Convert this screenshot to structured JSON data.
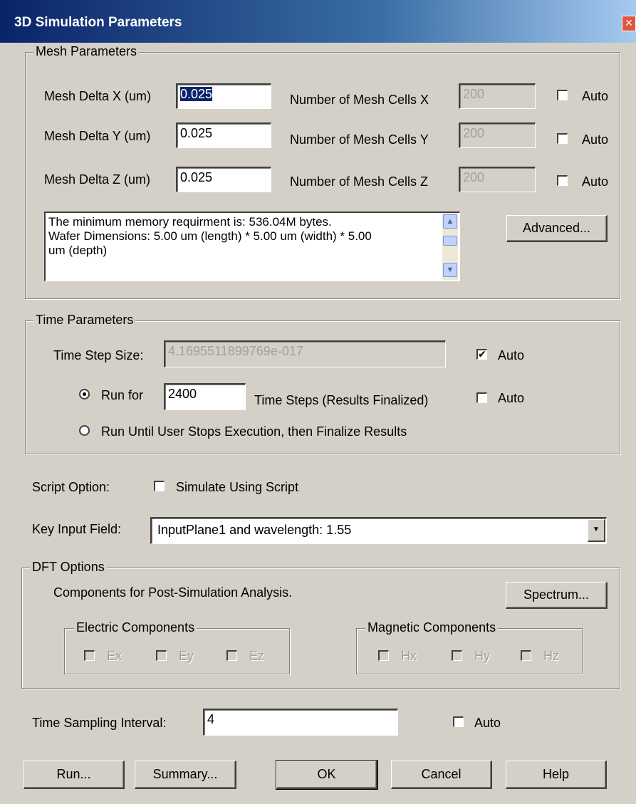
{
  "window": {
    "title": "3D Simulation Parameters",
    "close_glyph": "✕"
  },
  "mesh": {
    "legend": "Mesh Parameters",
    "rows": [
      {
        "delta_label": "Mesh Delta X (um)",
        "delta_value": "0.025",
        "cells_label": "Number of Mesh Cells X",
        "cells_value": "200",
        "auto_label": "Auto",
        "auto_checked": false
      },
      {
        "delta_label": "Mesh Delta Y (um)",
        "delta_value": "0.025",
        "cells_label": "Number of Mesh Cells Y",
        "cells_value": "200",
        "auto_label": "Auto",
        "auto_checked": false
      },
      {
        "delta_label": "Mesh Delta Z (um)",
        "delta_value": "0.025",
        "cells_label": "Number of Mesh Cells Z",
        "cells_value": "200",
        "auto_label": "Auto",
        "auto_checked": false
      }
    ],
    "info_lines": [
      "The minimum memory requirment is: 536.04M bytes.",
      "Wafer Dimensions: 5.00 um (length) * 5.00 um (width) * 5.00",
      "um (depth)"
    ],
    "advanced_label": "Advanced..."
  },
  "time": {
    "legend": "Time Parameters",
    "step_label": "Time Step Size:",
    "step_value": "4.1695511899769e-017",
    "step_auto_label": "Auto",
    "step_auto_checked": true,
    "run_for_label": "Run for",
    "run_for_value": "2400",
    "run_for_suffix": "Time Steps (Results Finalized)",
    "run_auto_label": "Auto",
    "run_auto_checked": false,
    "run_until_label": "Run Until User Stops Execution, then Finalize Results",
    "selected_option": "run_for"
  },
  "script": {
    "label": "Script Option:",
    "checkbox_label": "Simulate Using Script",
    "checked": false
  },
  "key_input": {
    "label": "Key Input Field:",
    "value": "InputPlane1 and wavelength: 1.55"
  },
  "dft": {
    "legend": "DFT Options",
    "description": "Components for Post-Simulation Analysis.",
    "spectrum_label": "Spectrum...",
    "electric": {
      "legend": "Electric Components",
      "items": [
        "Ex",
        "Ey",
        "Ez"
      ]
    },
    "magnetic": {
      "legend": "Magnetic Components",
      "items": [
        "Hx",
        "Hy",
        "Hz"
      ]
    }
  },
  "sampling": {
    "label": "Time Sampling Interval:",
    "value": "4",
    "auto_label": "Auto",
    "auto_checked": false
  },
  "buttons": {
    "run": "Run...",
    "summary": "Summary...",
    "ok": "OK",
    "cancel": "Cancel",
    "help": "Help"
  },
  "check_glyph": "✔"
}
